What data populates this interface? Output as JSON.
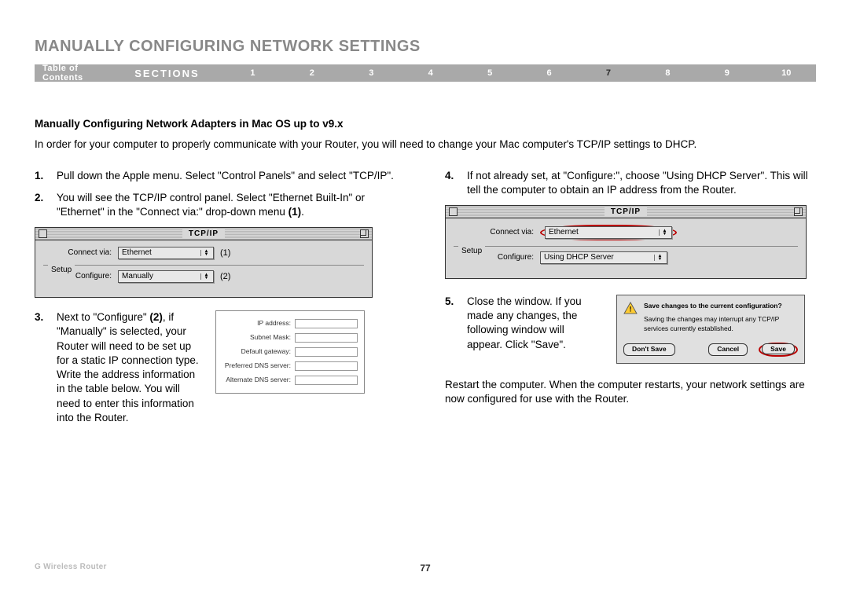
{
  "page_title": "MANUALLY CONFIGURING NETWORK SETTINGS",
  "nav": {
    "toc": "Table of Contents",
    "sections_label": "SECTIONS",
    "items": [
      "1",
      "2",
      "3",
      "4",
      "5",
      "6",
      "7",
      "8",
      "9",
      "10"
    ],
    "active_index": 6
  },
  "subheading": "Manually Configuring Network Adapters in Mac OS up to v9.x",
  "intro": "In order for your computer to properly communicate with your Router, you will need to change your Mac computer's TCP/IP settings to DHCP.",
  "steps_left": {
    "s1_num": "1.",
    "s1_txt": "Pull down the Apple menu. Select \"Control Panels\" and select \"TCP/IP\".",
    "s2_num": "2.",
    "s2_txt_a": "You will see the TCP/IP control panel. Select \"Ethernet Built-In\" or \"Ethernet\" in the \"Connect via:\" drop-down menu ",
    "s2_txt_b": "(1)",
    "s2_txt_c": ".",
    "s3_num": "3.",
    "s3_txt_a": "Next to \"Configure\" ",
    "s3_txt_b": "(2)",
    "s3_txt_c": ", if \"Manually\" is selected, your Router will need to be set up for a static IP connection type. Write the address information in the table below. You will need to enter this information into the Router."
  },
  "steps_right": {
    "s4_num": "4.",
    "s4_txt": "If not already set, at \"Configure:\", choose \"Using DHCP Server\". This will tell the computer to obtain an IP address from the Router.",
    "s5_num": "5.",
    "s5_txt": "Close the window. If you made any changes, the following window will appear. Click \"Save\"."
  },
  "tcpip_window": {
    "title": "TCP/IP",
    "connect_via_label": "Connect via:",
    "connect_via_value": "Ethernet",
    "setup_label": "Setup",
    "configure_label": "Configure:",
    "configure_value_left": "Manually",
    "configure_value_right": "Using DHCP Server",
    "annot1": "(1)",
    "annot2": "(2)"
  },
  "ip_table": {
    "r1": "IP address:",
    "r2": "Subnet Mask:",
    "r3": "Default gateway:",
    "r4": "Preferred DNS server:",
    "r5": "Alternate DNS server:"
  },
  "save_dialog": {
    "msg": "Save changes to the current configuration?",
    "submsg": "Saving the changes may interrupt any TCP/IP services currently established.",
    "dont_save": "Don't Save",
    "cancel": "Cancel",
    "save": "Save"
  },
  "restart_note": "Restart the computer. When the computer restarts, your network settings are now configured for use with the Router.",
  "footer": {
    "left": "G Wireless Router",
    "page": "77"
  }
}
